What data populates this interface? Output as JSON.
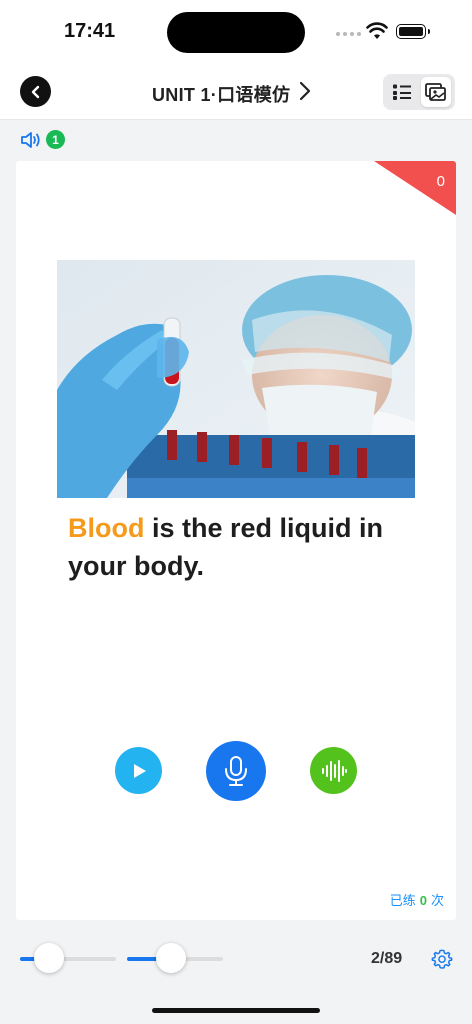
{
  "status_bar": {
    "time": "17:41"
  },
  "header": {
    "title": "UNIT 1·口语模仿",
    "back_icon": "chevron-left-icon",
    "next_icon": "chevron-right-icon",
    "view_modes": [
      "list",
      "image"
    ],
    "active_view": "image"
  },
  "audio": {
    "icon": "speaker-icon",
    "badge": "1"
  },
  "card": {
    "corner_count": "0",
    "image": "lab scientist holding blood test tube",
    "sentence_keyword": "Blood",
    "sentence_rest": " is the red liquid in your body.",
    "practice": {
      "prefix": "已练",
      "count": "0",
      "suffix": "次"
    }
  },
  "controls": {
    "play_icon": "play-icon",
    "mic_icon": "microphone-icon",
    "wave_icon": "waveform-icon"
  },
  "footer": {
    "slider1_value": 0.3,
    "slider2_value": 0.46,
    "page_counter": "2/89"
  },
  "colors": {
    "accent": "#1877ee",
    "keyword": "#f59a1b",
    "corner": "#f24f4f",
    "play": "#23b3f0",
    "wave": "#53c21c",
    "badge": "#19b955"
  }
}
